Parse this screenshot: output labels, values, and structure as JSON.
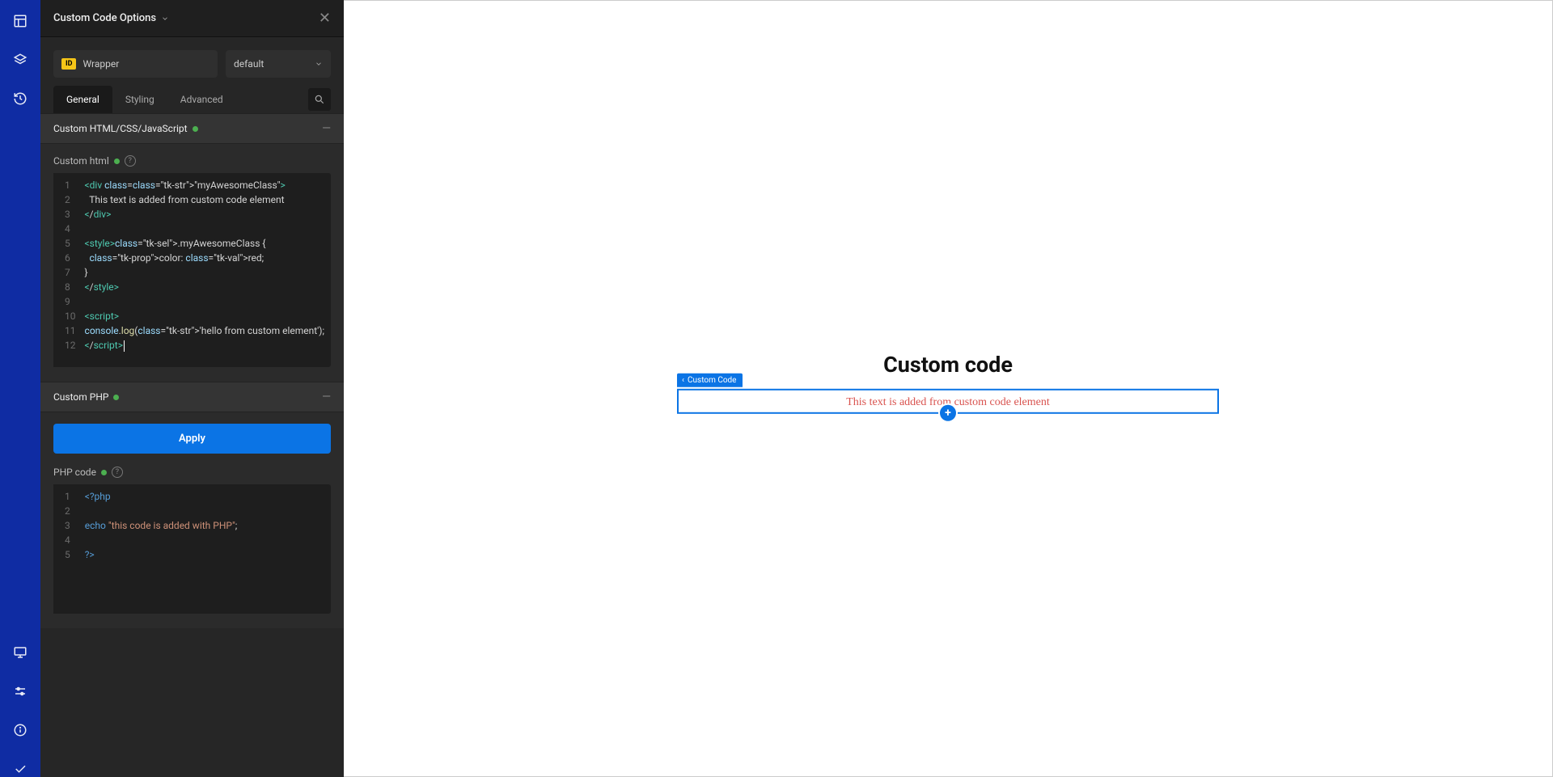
{
  "rail_icons": [
    "panel-icon",
    "layers-icon",
    "history-icon",
    "desktop-icon",
    "sliders-icon",
    "info-icon",
    "check-icon"
  ],
  "panel": {
    "title": "Custom Code Options",
    "id_badge": "ID",
    "id_value": "Wrapper",
    "preset": "default"
  },
  "tabs": {
    "items": [
      "General",
      "Styling",
      "Advanced"
    ],
    "active_index": 0
  },
  "section_html": {
    "title": "Custom HTML/CSS/JavaScript",
    "field_label": "Custom html",
    "code_lines": [
      "<div class=\"myAwesomeClass\">",
      "  This text is added from custom code element",
      "</div>",
      "",
      "<style>.myAwesomeClass {",
      "  color: red;",
      "}",
      "</style>",
      "",
      "<script>",
      "console.log('hello from custom element');",
      "</script>"
    ]
  },
  "section_php": {
    "title": "Custom PHP",
    "apply_label": "Apply",
    "field_label": "PHP code",
    "code_lines": [
      "<?php",
      "",
      "echo \"this code is added with PHP\";",
      "",
      "?>"
    ]
  },
  "canvas": {
    "page_title": "Custom code",
    "selection_label": "Custom Code",
    "rendered_text": "This text is added from custom code element"
  }
}
